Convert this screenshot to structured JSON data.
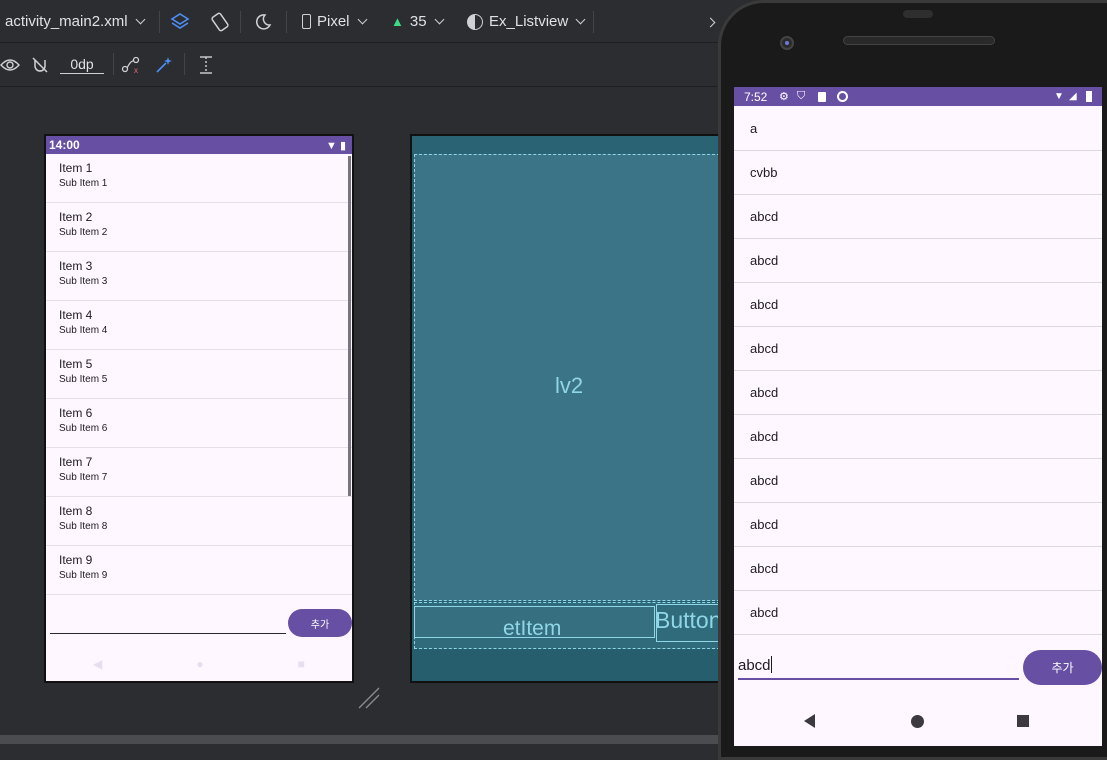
{
  "toolbar": {
    "file_name": "activity_main2.xml",
    "device": "Pixel",
    "api_level": "35",
    "theme": "Ex_Listview",
    "margin_value": "0dp"
  },
  "design_preview": {
    "status_time": "14:00",
    "items": [
      {
        "title": "Item 1",
        "subtitle": "Sub Item 1"
      },
      {
        "title": "Item 2",
        "subtitle": "Sub Item 2"
      },
      {
        "title": "Item 3",
        "subtitle": "Sub Item 3"
      },
      {
        "title": "Item 4",
        "subtitle": "Sub Item 4"
      },
      {
        "title": "Item 5",
        "subtitle": "Sub Item 5"
      },
      {
        "title": "Item 6",
        "subtitle": "Sub Item 6"
      },
      {
        "title": "Item 7",
        "subtitle": "Sub Item 7"
      },
      {
        "title": "Item 8",
        "subtitle": "Sub Item 8"
      },
      {
        "title": "Item 9",
        "subtitle": "Sub Item 9"
      }
    ],
    "button_label": "추가"
  },
  "blueprint": {
    "listview_id": "lv2",
    "edittext_id": "etItem",
    "button_label": "Button"
  },
  "emulator": {
    "status_time": "7:52",
    "list_items": [
      "a",
      "cvbb",
      "abcd",
      "abcd",
      "abcd",
      "abcd",
      "abcd",
      "abcd",
      "abcd",
      "abcd",
      "abcd",
      "abcd"
    ],
    "input_value": "abcd",
    "button_label": "추가"
  },
  "colors": {
    "primary": "#6750a4",
    "surface": "#fef7ff",
    "ide_background": "#2b2d30",
    "blueprint": "#265e6e",
    "blueprint_outline": "#8fd6e6"
  }
}
